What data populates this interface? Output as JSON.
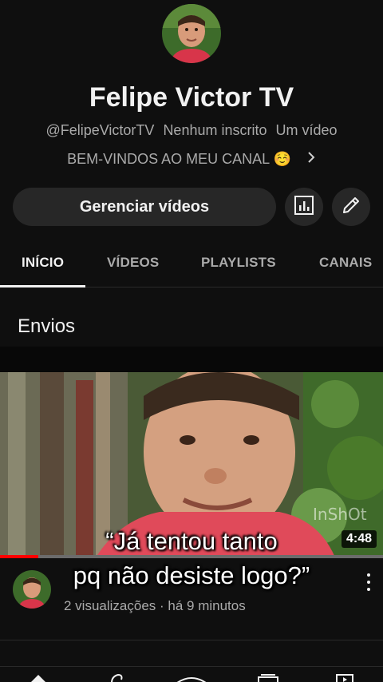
{
  "channel": {
    "name": "Felipe Victor TV",
    "handle": "@FelipeVictorTV",
    "subscribers": "Nenhum inscrito",
    "video_count": "Um vídeo",
    "description": "BEM-VINDOS AO MEU CANAL ☺️"
  },
  "actions": {
    "manage_label": "Gerenciar vídeos",
    "stats_icon": "analytics-icon",
    "edit_icon": "pencil-icon"
  },
  "tabs": [
    {
      "label": "INÍCIO",
      "active": true
    },
    {
      "label": "VÍDEOS",
      "active": false
    },
    {
      "label": "PLAYLISTS",
      "active": false
    },
    {
      "label": "CANAIS",
      "active": false
    }
  ],
  "section": {
    "title": "Envios"
  },
  "video": {
    "duration": "4:48",
    "stats": "2 visualizações · há 9 minutos",
    "watermark": "InShOt",
    "progress": 0.1
  },
  "overlay_caption": {
    "line1": "“Já tentou tanto",
    "line2": "pq não desiste logo?”"
  },
  "colors": {
    "background": "#0f0f0f",
    "button": "#272727",
    "progress": "#ff0000"
  }
}
